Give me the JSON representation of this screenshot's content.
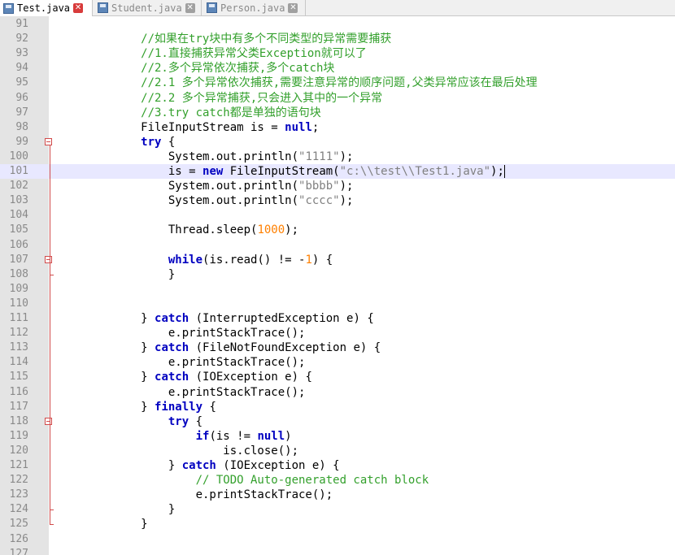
{
  "tabs": [
    {
      "label": "Test.java",
      "active": true
    },
    {
      "label": "Student.java",
      "active": false
    },
    {
      "label": "Person.java",
      "active": false
    }
  ],
  "colors": {
    "keyword": "#0000c0",
    "comment": "#33a02c",
    "string": "#808080",
    "number": "#ff8000",
    "current_line": "#e8e8ff",
    "fold_marker": "#d14a4a"
  },
  "editor": {
    "current_line": 101,
    "lines": [
      {
        "n": "91",
        "tokens": []
      },
      {
        "n": "92",
        "tokens": [
          [
            "cm",
            "            //如果在try块中有多个不同类型的异常需要捕获"
          ]
        ]
      },
      {
        "n": "93",
        "tokens": [
          [
            "cm",
            "            //1.直接捕获异常父类Exception就可以了"
          ]
        ]
      },
      {
        "n": "94",
        "tokens": [
          [
            "cm",
            "            //2.多个异常依次捕获,多个catch块"
          ]
        ]
      },
      {
        "n": "95",
        "tokens": [
          [
            "cm",
            "            //2.1 多个异常依次捕获,需要注意异常的顺序问题,父类异常应该在最后处理"
          ]
        ]
      },
      {
        "n": "96",
        "tokens": [
          [
            "cm",
            "            //2.2 多个异常捕获,只会进入其中的一个异常"
          ]
        ]
      },
      {
        "n": "97",
        "tokens": [
          [
            "cm",
            "            //3.try catch都是单独的语句块"
          ]
        ]
      },
      {
        "n": "98",
        "tokens": [
          [
            "",
            "            FileInputStream is = "
          ],
          [
            "kw",
            "null"
          ],
          [
            "",
            ";"
          ]
        ]
      },
      {
        "n": "99",
        "fold": "start",
        "tokens": [
          [
            "",
            "            "
          ],
          [
            "kw",
            "try"
          ],
          [
            "",
            " {"
          ]
        ]
      },
      {
        "n": "100",
        "tokens": [
          [
            "",
            "                System.out.println("
          ],
          [
            "st",
            "\"1111\""
          ],
          [
            "",
            ");"
          ]
        ]
      },
      {
        "n": "101",
        "tokens": [
          [
            "",
            "                is = "
          ],
          [
            "kw",
            "new"
          ],
          [
            "",
            " FileInputStream("
          ],
          [
            "st",
            "\"c:\\\\test\\\\Test1.java\""
          ],
          [
            "",
            ");"
          ]
        ]
      },
      {
        "n": "102",
        "tokens": [
          [
            "",
            "                System.out.println("
          ],
          [
            "st",
            "\"bbbb\""
          ],
          [
            "",
            ");"
          ]
        ]
      },
      {
        "n": "103",
        "tokens": [
          [
            "",
            "                System.out.println("
          ],
          [
            "st",
            "\"cccc\""
          ],
          [
            "",
            ");"
          ]
        ]
      },
      {
        "n": "104",
        "tokens": []
      },
      {
        "n": "105",
        "tokens": [
          [
            "",
            "                Thread.sleep("
          ],
          [
            "nm",
            "1000"
          ],
          [
            "",
            ");"
          ]
        ]
      },
      {
        "n": "106",
        "tokens": []
      },
      {
        "n": "107",
        "fold": "start",
        "tokens": [
          [
            "",
            "                "
          ],
          [
            "kw",
            "while"
          ],
          [
            "",
            "(is.read() != -"
          ],
          [
            "nm",
            "1"
          ],
          [
            "",
            ") {"
          ]
        ]
      },
      {
        "n": "108",
        "fold": "end",
        "tokens": [
          [
            "",
            "                }"
          ]
        ]
      },
      {
        "n": "109",
        "tokens": []
      },
      {
        "n": "110",
        "tokens": []
      },
      {
        "n": "111",
        "tokens": [
          [
            "",
            "            } "
          ],
          [
            "kw",
            "catch"
          ],
          [
            "",
            " (InterruptedException e) {"
          ]
        ]
      },
      {
        "n": "112",
        "tokens": [
          [
            "",
            "                e.printStackTrace();"
          ]
        ]
      },
      {
        "n": "113",
        "tokens": [
          [
            "",
            "            } "
          ],
          [
            "kw",
            "catch"
          ],
          [
            "",
            " (FileNotFoundException e) {"
          ]
        ]
      },
      {
        "n": "114",
        "tokens": [
          [
            "",
            "                e.printStackTrace();"
          ]
        ]
      },
      {
        "n": "115",
        "tokens": [
          [
            "",
            "            } "
          ],
          [
            "kw",
            "catch"
          ],
          [
            "",
            " (IOException e) {"
          ]
        ]
      },
      {
        "n": "116",
        "tokens": [
          [
            "",
            "                e.printStackTrace();"
          ]
        ]
      },
      {
        "n": "117",
        "tokens": [
          [
            "",
            "            } "
          ],
          [
            "kw",
            "finally"
          ],
          [
            "",
            " {"
          ]
        ]
      },
      {
        "n": "118",
        "fold": "start",
        "tokens": [
          [
            "",
            "                "
          ],
          [
            "kw",
            "try"
          ],
          [
            "",
            " {"
          ]
        ]
      },
      {
        "n": "119",
        "tokens": [
          [
            "",
            "                    "
          ],
          [
            "kw",
            "if"
          ],
          [
            "",
            "(is != "
          ],
          [
            "kw",
            "null"
          ],
          [
            "",
            ")"
          ]
        ]
      },
      {
        "n": "120",
        "tokens": [
          [
            "",
            "                        is.close();"
          ]
        ]
      },
      {
        "n": "121",
        "tokens": [
          [
            "",
            "                } "
          ],
          [
            "kw",
            "catch"
          ],
          [
            "",
            " (IOException e) {"
          ]
        ]
      },
      {
        "n": "122",
        "tokens": [
          [
            "cm",
            "                    // TODO Auto-generated catch block"
          ]
        ]
      },
      {
        "n": "123",
        "tokens": [
          [
            "",
            "                    e.printStackTrace();"
          ]
        ]
      },
      {
        "n": "124",
        "fold": "end",
        "tokens": [
          [
            "",
            "                }"
          ]
        ]
      },
      {
        "n": "125",
        "fold": "end",
        "tokens": [
          [
            "",
            "            }"
          ]
        ]
      },
      {
        "n": "126",
        "tokens": []
      },
      {
        "n": "127",
        "tokens": []
      }
    ]
  }
}
